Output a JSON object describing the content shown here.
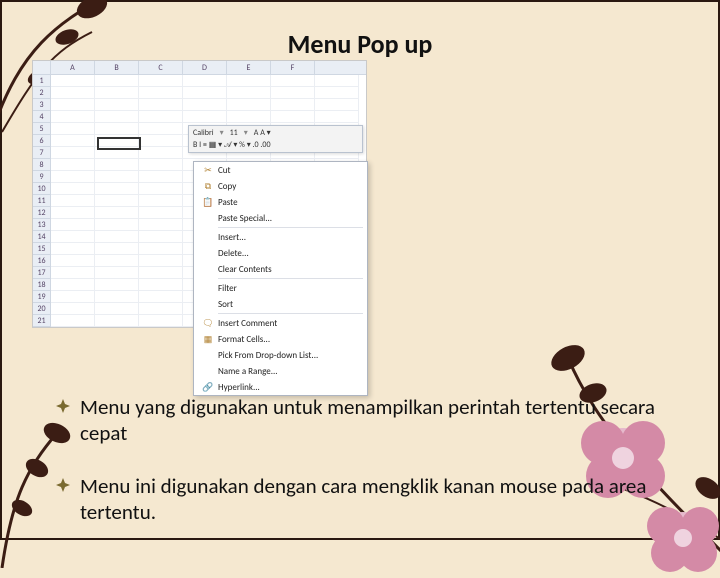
{
  "title": "Menu Pop up",
  "excel": {
    "columns": [
      "A",
      "B",
      "C",
      "D",
      "E",
      "F"
    ],
    "rows": [
      "1",
      "2",
      "3",
      "4",
      "5",
      "6",
      "7",
      "8",
      "9",
      "10",
      "11",
      "12",
      "13",
      "14",
      "15",
      "16",
      "17",
      "18",
      "19",
      "20",
      "21"
    ]
  },
  "miniToolbar": {
    "line1_font": "Calibri",
    "line1_size": "11",
    "line1_rest": "A A ▾",
    "line2": "B I ≡ ▦ ▾ 𝒜 ▾ % ▾ .0 .00"
  },
  "contextMenu": {
    "items": [
      {
        "icon": "✂",
        "label": "Cut"
      },
      {
        "icon": "⧉",
        "label": "Copy"
      },
      {
        "icon": "📋",
        "label": "Paste"
      },
      {
        "icon": "",
        "label": "Paste Special..."
      },
      {
        "icon": "",
        "label": "Insert..."
      },
      {
        "icon": "",
        "label": "Delete..."
      },
      {
        "icon": "",
        "label": "Clear Contents"
      },
      {
        "icon": "",
        "label": "Filter"
      },
      {
        "icon": "",
        "label": "Sort"
      },
      {
        "icon": "🗨",
        "label": "Insert Comment"
      },
      {
        "icon": "▦",
        "label": "Format Cells..."
      },
      {
        "icon": "",
        "label": "Pick From Drop-down List..."
      },
      {
        "icon": "",
        "label": "Name a Range..."
      },
      {
        "icon": "🔗",
        "label": "Hyperlink..."
      }
    ],
    "dividersAfter": [
      3,
      6,
      8
    ]
  },
  "bullets": [
    "Menu yang digunakan untuk menampilkan perintah tertentu secara cepat",
    "Menu ini digunakan dengan cara mengklik kanan mouse pada area tertentu."
  ],
  "colors": {
    "dark": "#3b1d14",
    "pink": "#d48aa6",
    "olive": "#7a6a2f"
  }
}
